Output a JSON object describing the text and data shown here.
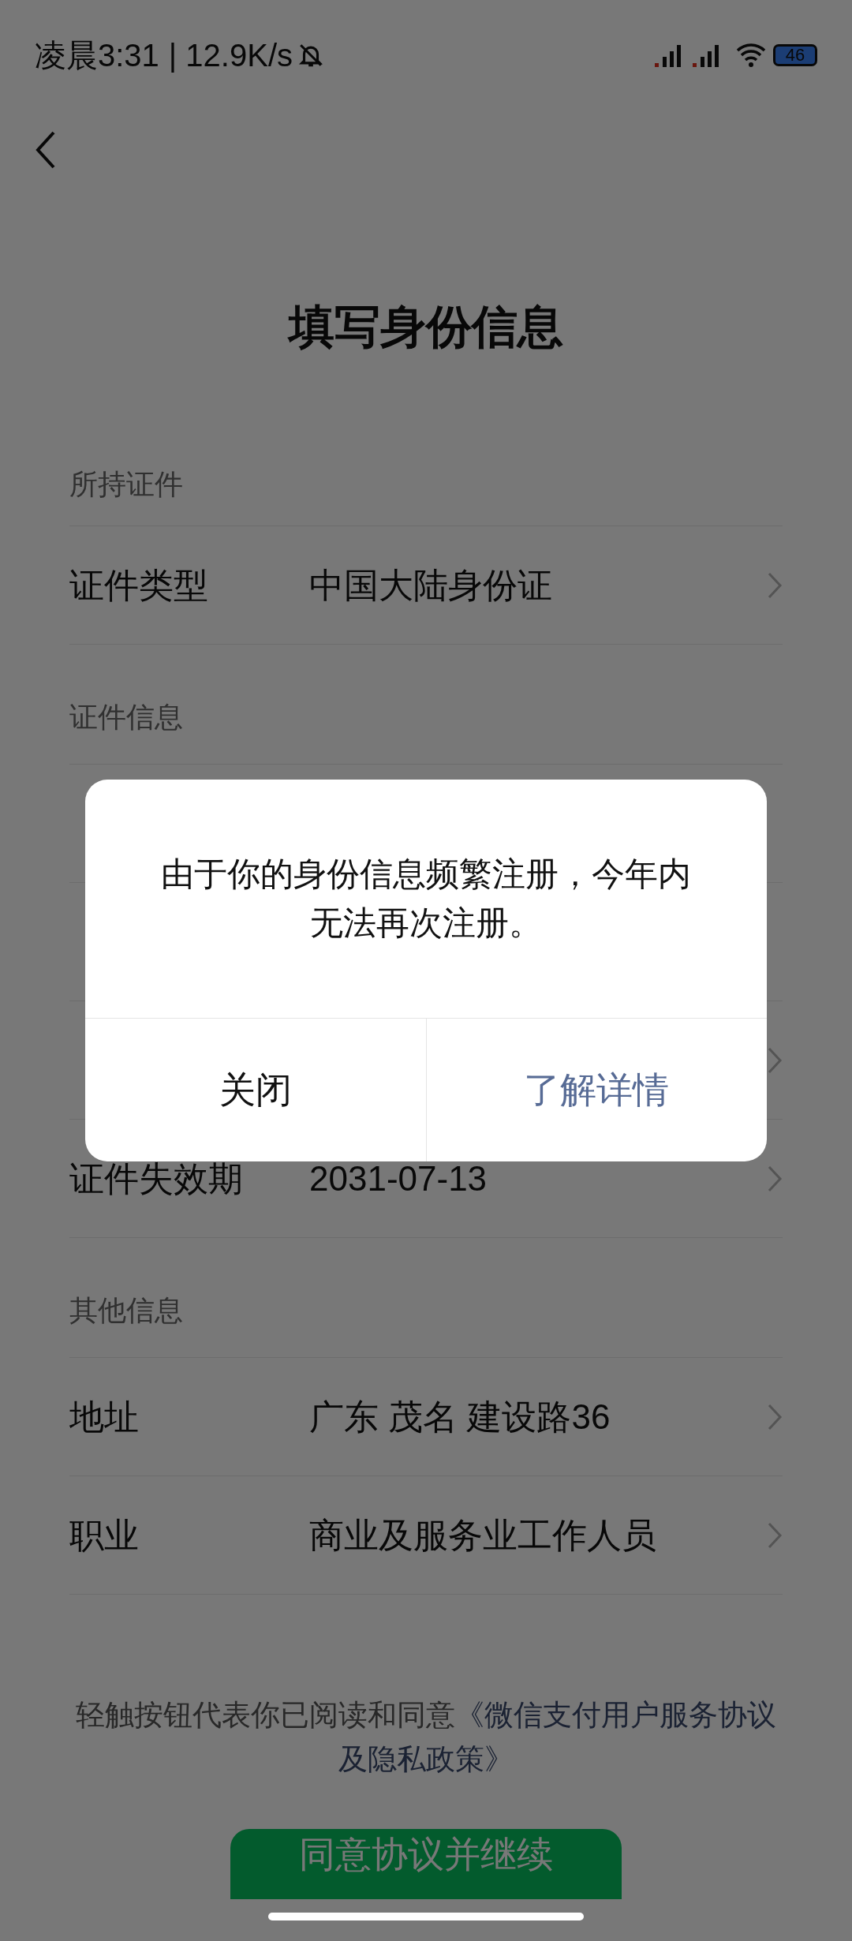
{
  "status_bar": {
    "time": "凌晨3:31",
    "speed": "| 12.9K/s",
    "battery": "46"
  },
  "title": "填写身份信息",
  "sections": [
    {
      "heading": "所持证件",
      "rows": [
        {
          "label": "证件类型",
          "value": "中国大陆身份证",
          "chevron": true
        }
      ]
    },
    {
      "heading": "证件信息",
      "rows": [
        {
          "chevron": false
        },
        {
          "chevron": false
        },
        {
          "chevron": true
        },
        {
          "label": "证件失效期",
          "value": "2031-07-13",
          "chevron": true
        }
      ]
    },
    {
      "heading": "其他信息",
      "rows": [
        {
          "label": "地址",
          "value": "广东 茂名 建设路36",
          "chevron": true
        },
        {
          "label": "职业",
          "value": "商业及服务业工作人员",
          "chevron": true
        }
      ]
    }
  ],
  "agreement": {
    "text": "轻触按钮代表你已阅读和同意",
    "link_part1": "《微信支付用户服务协议",
    "link_part2": "及隐私政策》"
  },
  "primary_button": "同意协议并继续",
  "dialog": {
    "message": "由于你的身份信息频繁注册，今年内无法再次注册。",
    "buttons": [
      {
        "label": "关闭",
        "kind": "plain"
      },
      {
        "label": "了解详情",
        "kind": "link"
      }
    ]
  }
}
